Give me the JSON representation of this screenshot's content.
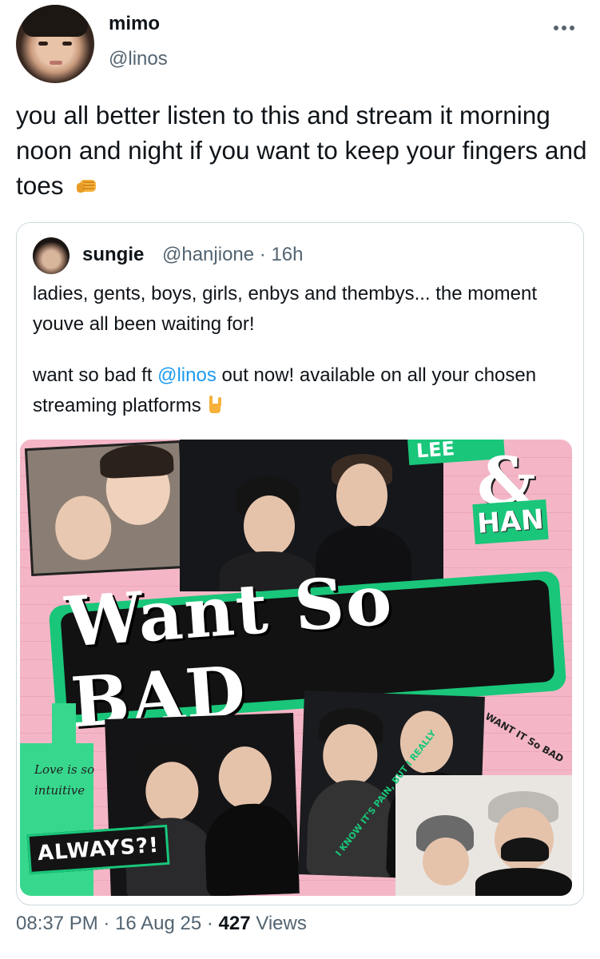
{
  "tweet": {
    "author_name": "mimo",
    "author_handle": "@linos",
    "text": "you all better listen to this and stream it morning noon and night if you want to keep your fingers and toes",
    "emoji_icon": "oncoming-fist",
    "more_icon": "ellipsis-icon"
  },
  "quote": {
    "author_name": "sungie",
    "handle_time": "@hanjione · 16h",
    "paragraph1": "ladies, gents, boys, girls, enbys and thembys... the moment youve all been waiting for!",
    "p2_before": "want so bad ft ",
    "p2_mention": "@linos",
    "p2_after": " out now! available on all your chosen streaming platforms",
    "emoji_icon": "sign-of-the-horns"
  },
  "poster": {
    "title": "Want So BAD",
    "amp": "&",
    "han": "HAN",
    "lee": "LEE",
    "love_text": "Love is so intuitive",
    "always": "ALWAYS?!",
    "want_it_text": "WANT IT So BAD",
    "know_text": "I KNOW IT'S PAIN, BUT I REALLY",
    "colors": {
      "background": "#f4b6c6",
      "accent_green": "#19c67a",
      "dark": "#141414"
    }
  },
  "meta": {
    "time": "08:37 PM",
    "date": "16 Aug 25",
    "views_count": "427",
    "views_label": "Views"
  }
}
